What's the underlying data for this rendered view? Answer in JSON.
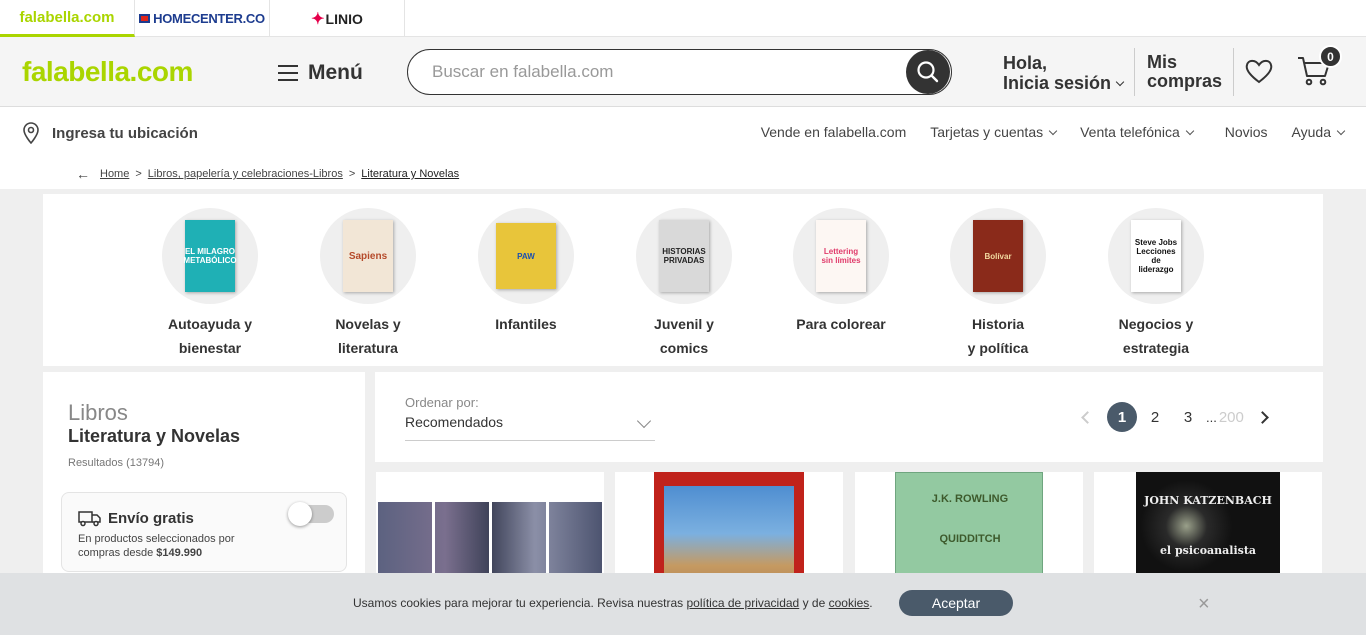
{
  "brands": [
    {
      "label": "falabella.com"
    },
    {
      "label": "HOMECENTER.CO"
    },
    {
      "label": "LINIO"
    }
  ],
  "header": {
    "logo": "falabella.com",
    "menu_label": "Menú",
    "search_placeholder": "Buscar en falabella.com",
    "greet_line1": "Hola,",
    "greet_line2": "Inicia sesión",
    "purchases_line1": "Mis",
    "purchases_line2": "compras",
    "cart_count": "0"
  },
  "location": {
    "label": "Ingresa tu ubicación",
    "links": [
      "Vende en falabella.com",
      "Tarjetas y cuentas",
      "Venta telefónica",
      "Novios",
      "Ayuda"
    ]
  },
  "breadcrumb": {
    "home": "Home",
    "level2": "Libros, papelería y celebraciones-Libros",
    "current": "Literatura y Novelas"
  },
  "categories": [
    {
      "line1": "Autoayuda y",
      "line2": "bienestar",
      "cover_text": "EL MILAGRO METABÓLICO",
      "color": "#1fb0b5"
    },
    {
      "line1": "Novelas y",
      "line2": "literatura",
      "cover_text": "Sapiens",
      "color": "#f2e6d6"
    },
    {
      "line1": "Infantiles",
      "line2": "",
      "cover_text": "PAW",
      "color": "#e8c53a"
    },
    {
      "line1": "Juvenil y",
      "line2": "comics",
      "cover_text": "HISTORIAS PRIVADAS",
      "color": "#d9d9d9"
    },
    {
      "line1": "Para colorear",
      "line2": "",
      "cover_text": "Lettering sin límites",
      "color": "#fdf7f3"
    },
    {
      "line1": "Historia",
      "line2": "y política",
      "cover_text": "Bolívar",
      "color": "#8a2a1a"
    },
    {
      "line1": "Negocios y",
      "line2": "estrategia",
      "cover_text": "Steve Jobs Lecciones de liderazgo",
      "color": "#ffffff"
    }
  ],
  "left_panel": {
    "title1": "Libros",
    "title2": "Literatura y Novelas",
    "results": "Resultados (13794)",
    "shipping_title": "Envío gratis",
    "shipping_desc": "En productos seleccionados por compras desde",
    "shipping_amount": "$149.990"
  },
  "sort": {
    "label": "Ordenar por:",
    "value": "Recomendados"
  },
  "pagination": {
    "pages": [
      "1",
      "2",
      "3"
    ],
    "ellipsis": "...",
    "last": "200"
  },
  "products": [
    {
      "cover_text": "",
      "color": "#6a6f86"
    },
    {
      "cover_text": "",
      "color": "#c0221b"
    },
    {
      "cover_text": "J.K. ROWLING QUIDDITCH",
      "color": "#93c9a1"
    },
    {
      "cover_text": "JOHN KATZENBACH el psicoanalista",
      "color": "#1b1b1b"
    }
  ],
  "cookie": {
    "text_before": "Usamos cookies para mejorar tu experiencia. Revisa nuestras",
    "privacy_link": "política de privacidad",
    "text_mid": "y de",
    "cookies_link": "cookies",
    "text_end": ".",
    "accept_label": "Aceptar",
    "close": "×"
  }
}
